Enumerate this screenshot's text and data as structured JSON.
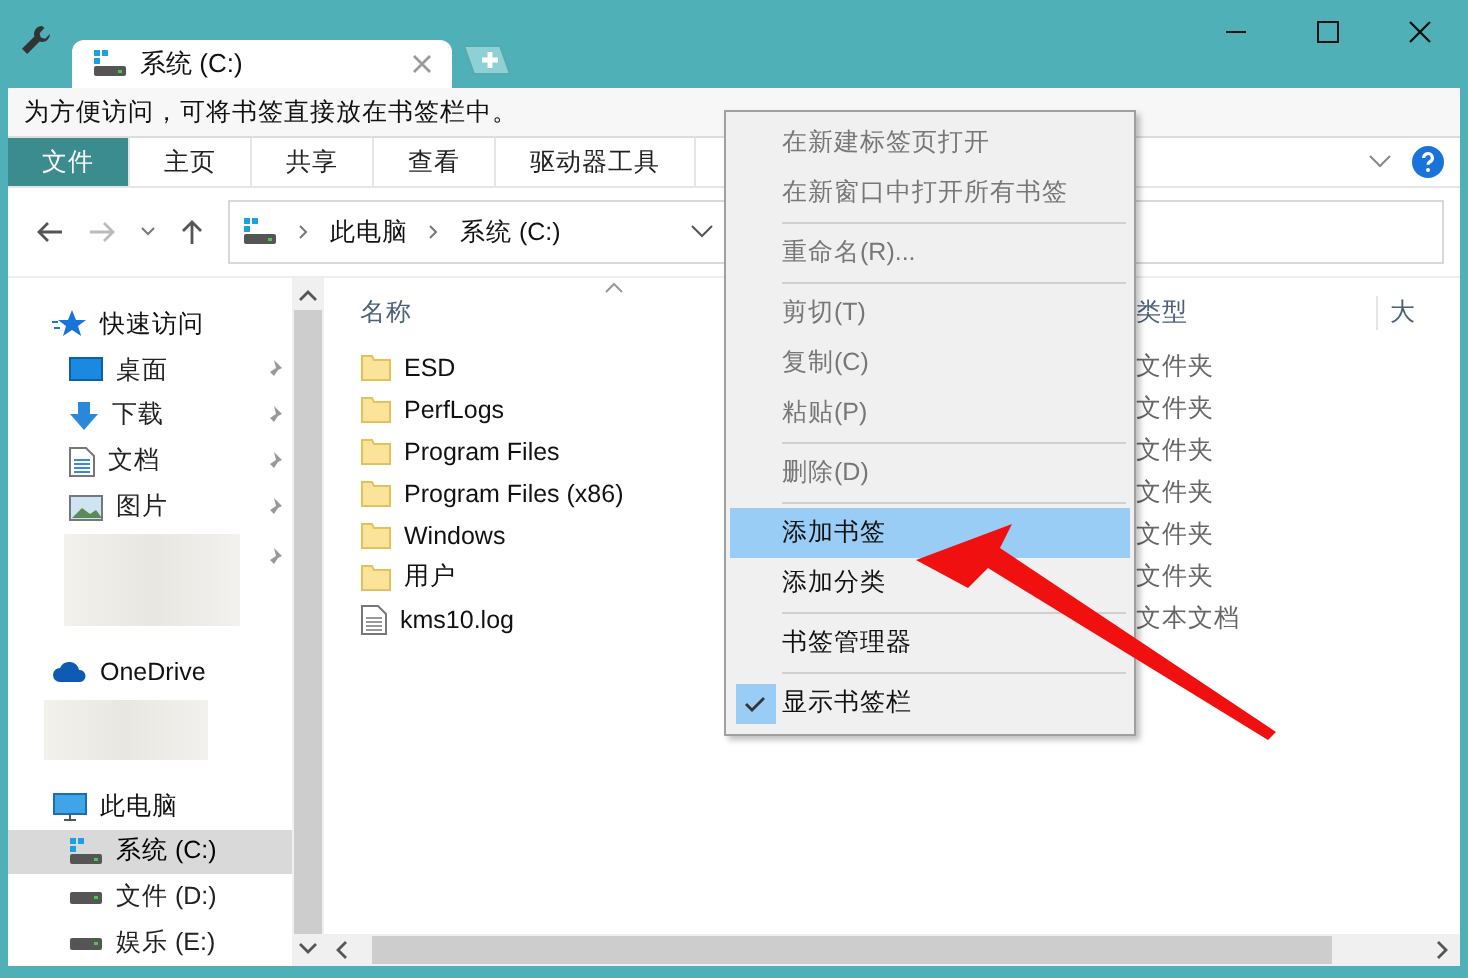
{
  "window": {
    "tab_title": "系统 (C:)"
  },
  "bookmark_bar": {
    "hint": "为方便访问，可将书签直接放在书签栏中。"
  },
  "ribbon": {
    "tabs": [
      {
        "label": "文件",
        "selected": true
      },
      {
        "label": "主页",
        "selected": false
      },
      {
        "label": "共享",
        "selected": false
      },
      {
        "label": "查看",
        "selected": false
      },
      {
        "label": "驱动器工具",
        "selected": false
      }
    ]
  },
  "address_bar": {
    "path": [
      "此电脑",
      "系统 (C:)"
    ]
  },
  "sidebar": {
    "items": [
      {
        "label": "快速访问",
        "kind": "quick",
        "selected": false,
        "children": [
          {
            "label": "桌面",
            "kind": "desktop",
            "pinned": true,
            "selected": false
          },
          {
            "label": "下载",
            "kind": "download",
            "pinned": true,
            "selected": false
          },
          {
            "label": "文档",
            "kind": "document",
            "pinned": true,
            "selected": false
          },
          {
            "label": "图片",
            "kind": "pictures",
            "pinned": true,
            "selected": false
          },
          {
            "kind": "redacted",
            "pinned": true
          }
        ]
      },
      {
        "label": "OneDrive",
        "kind": "cloud",
        "selected": false,
        "children": [
          {
            "kind": "redacted"
          }
        ]
      },
      {
        "label": "此电脑",
        "kind": "pc",
        "selected": false,
        "children": [
          {
            "label": "系统 (C:)",
            "kind": "system_drive",
            "pinned": false,
            "selected": true
          },
          {
            "label": "文件 (D:)",
            "kind": "drive",
            "pinned": false,
            "selected": false
          },
          {
            "label": "娱乐 (E:)",
            "kind": "drive",
            "pinned": false,
            "selected": false
          }
        ]
      }
    ]
  },
  "file_list": {
    "columns": [
      "名称",
      "类型",
      "大"
    ],
    "rows": [
      {
        "name": "ESD",
        "type": "文件夹",
        "kind": "folder"
      },
      {
        "name": "PerfLogs",
        "type": "文件夹",
        "kind": "folder"
      },
      {
        "name": "Program Files",
        "type": "文件夹",
        "kind": "folder"
      },
      {
        "name": "Program Files (x86)",
        "type": "文件夹",
        "kind": "folder"
      },
      {
        "name": "Windows",
        "type": "文件夹",
        "kind": "folder"
      },
      {
        "name": "用户",
        "type": "文件夹",
        "kind": "folder"
      },
      {
        "name": "kms10.log",
        "type": "文本文档",
        "kind": "file"
      }
    ]
  },
  "context_menu": {
    "items": [
      {
        "kind": "item",
        "label": "在新建标签页打开",
        "disabled": true,
        "selected": false,
        "checked": false
      },
      {
        "kind": "item",
        "label": "在新窗口中打开所有书签",
        "disabled": true,
        "selected": false,
        "checked": false
      },
      {
        "kind": "separator"
      },
      {
        "kind": "item",
        "label": "重命名(R)...",
        "disabled": true,
        "selected": false,
        "checked": false
      },
      {
        "kind": "separator"
      },
      {
        "kind": "item",
        "label": "剪切(T)",
        "disabled": true,
        "selected": false,
        "checked": false
      },
      {
        "kind": "item",
        "label": "复制(C)",
        "disabled": true,
        "selected": false,
        "checked": false
      },
      {
        "kind": "item",
        "label": "粘贴(P)",
        "disabled": true,
        "selected": false,
        "checked": false
      },
      {
        "kind": "separator"
      },
      {
        "kind": "item",
        "label": "删除(D)",
        "disabled": true,
        "selected": false,
        "checked": false
      },
      {
        "kind": "separator"
      },
      {
        "kind": "item",
        "label": "添加书签",
        "disabled": false,
        "selected": true,
        "checked": false
      },
      {
        "kind": "item",
        "label": "添加分类",
        "disabled": false,
        "selected": false,
        "checked": false
      },
      {
        "kind": "separator"
      },
      {
        "kind": "item",
        "label": "书签管理器",
        "disabled": false,
        "selected": false,
        "checked": false
      },
      {
        "kind": "separator"
      },
      {
        "kind": "item",
        "label": "显示书签栏",
        "disabled": false,
        "selected": false,
        "checked": true
      }
    ]
  }
}
